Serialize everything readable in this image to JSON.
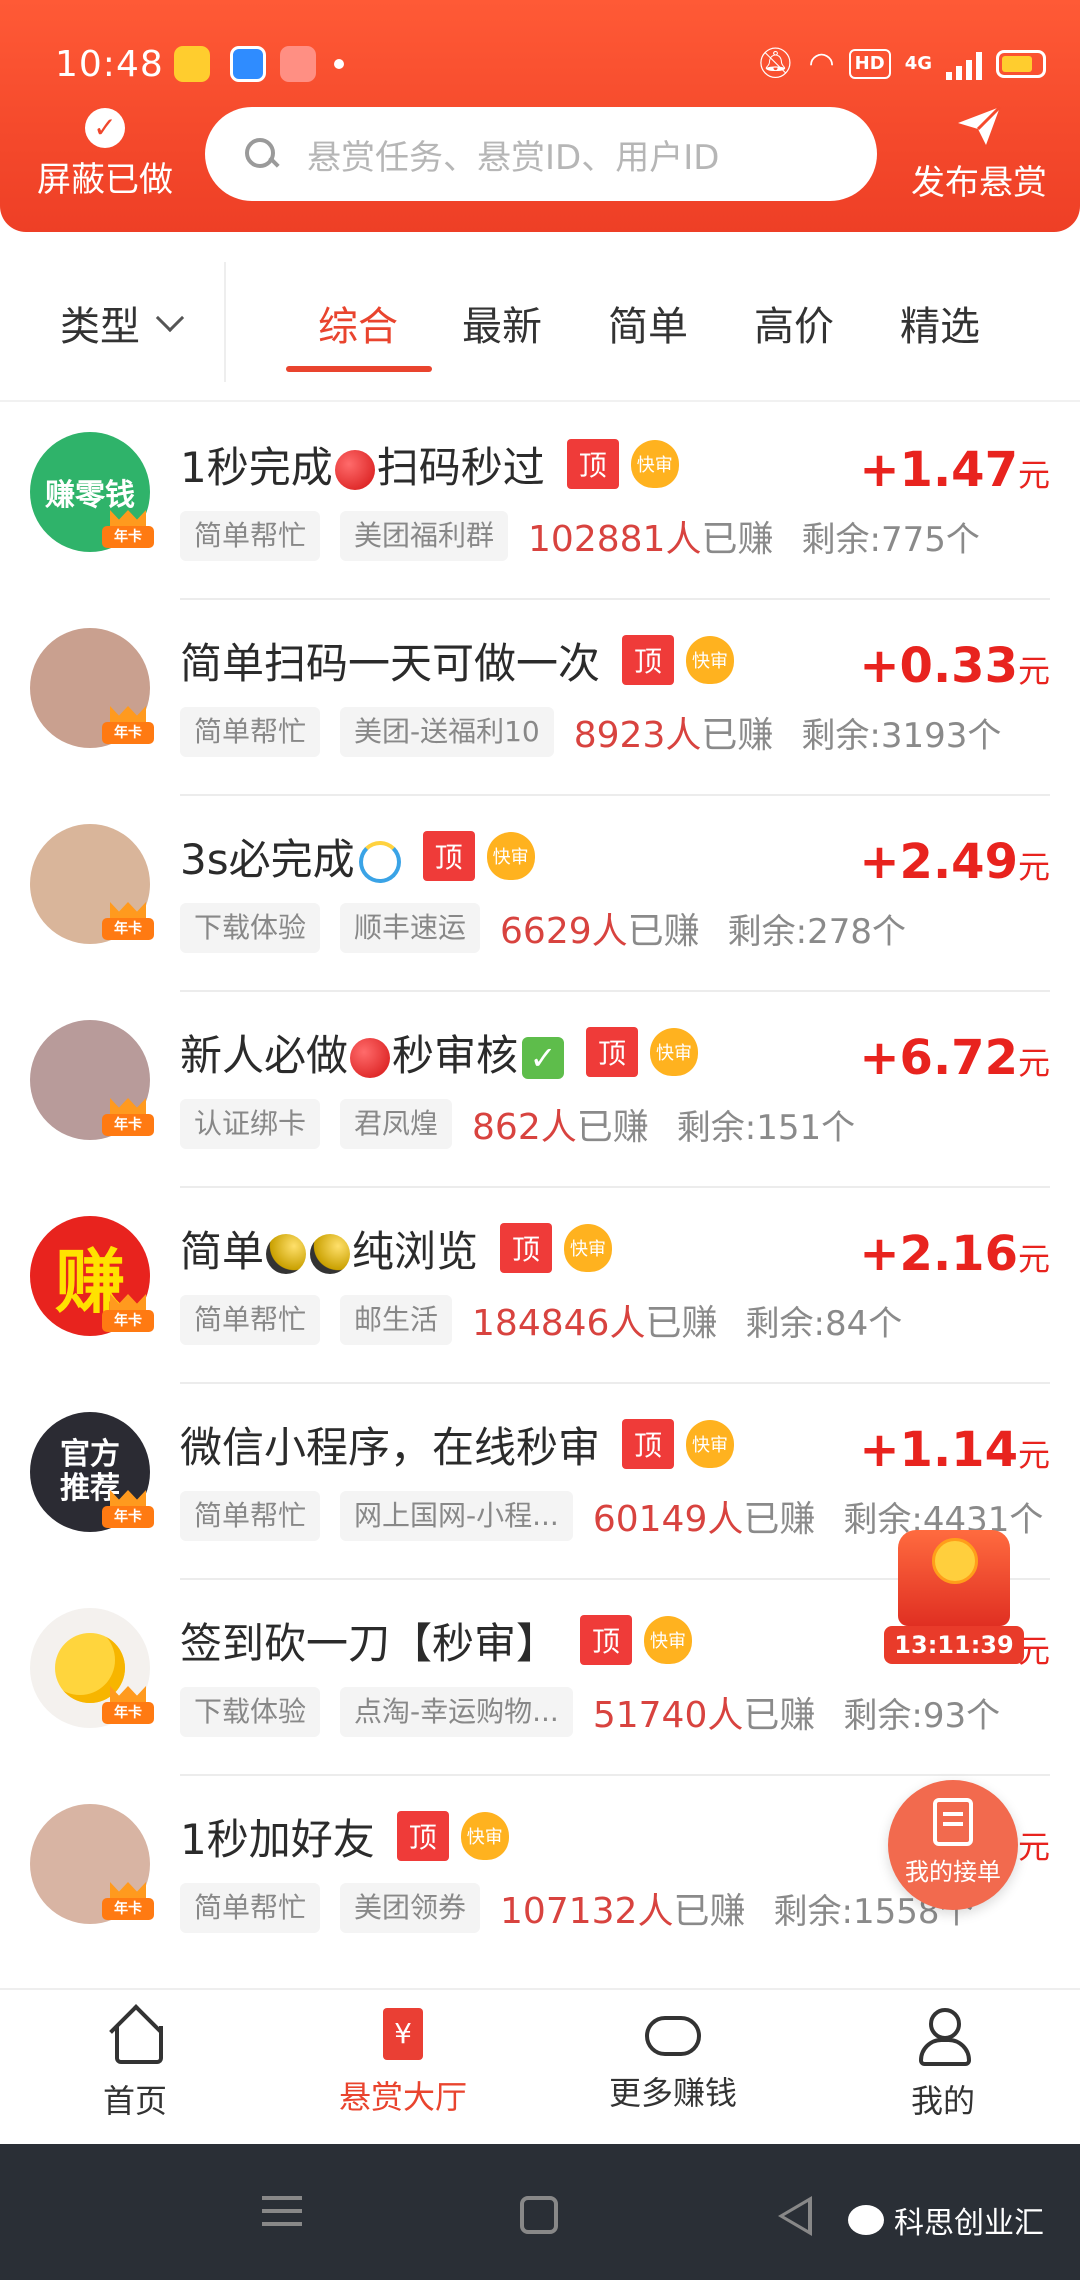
{
  "statusbar": {
    "time": "10:48",
    "network": "4G",
    "hd": "HD"
  },
  "header": {
    "hide_done_label": "屏蔽已做",
    "search_placeholder": "悬赏任务、悬赏ID、用户ID",
    "publish_label": "发布悬赏"
  },
  "filters": {
    "type_label": "类型",
    "tabs": [
      "综合",
      "最新",
      "简单",
      "高价",
      "精选"
    ],
    "active_tab": "综合"
  },
  "badges": {
    "top": "顶",
    "fast": "快审",
    "annual": "年卡"
  },
  "tasks": [
    {
      "title": "1秒完成",
      "title_emoji": "red-circle",
      "title_suffix": "扫码秒过",
      "price": "+1.47",
      "unit": "元",
      "tag1": "简单帮忙",
      "tag2": "美团福利群",
      "earned_count": "102881人",
      "earned_suffix": "已赚",
      "remain": "剩余:775个",
      "avatar_text": "赚零钱",
      "avatar_color": "#2fb36a"
    },
    {
      "title": "简单扫码一天可做一次",
      "title_emoji": "",
      "title_suffix": "",
      "price": "+0.33",
      "unit": "元",
      "tag1": "简单帮忙",
      "tag2": "美团-送福利10",
      "earned_count": "8923人",
      "earned_suffix": "已赚",
      "remain": "剩余:3193个",
      "avatar_text": "",
      "avatar_color": "#c9a08f"
    },
    {
      "title": "3s必完成",
      "title_emoji": "cyclone",
      "title_suffix": "",
      "price": "+2.49",
      "unit": "元",
      "tag1": "下载体验",
      "tag2": "顺丰速运",
      "earned_count": "6629人",
      "earned_suffix": "已赚",
      "remain": "剩余:278个",
      "avatar_text": "",
      "avatar_color": "#d9b59a"
    },
    {
      "title": "新人必做",
      "title_emoji": "red-circle",
      "title_suffix": "秒审核",
      "title_end_emoji": "check",
      "price": "+6.72",
      "unit": "元",
      "tag1": "认证绑卡",
      "tag2": "君凤煌",
      "earned_count": "862人",
      "earned_suffix": "已赚",
      "remain": "剩余:151个",
      "avatar_text": "",
      "avatar_color": "#b89b9a"
    },
    {
      "title": "简单",
      "title_emoji": "moon",
      "title_suffix": "纯浏览",
      "price": "+2.16",
      "unit": "元",
      "tag1": "简单帮忙",
      "tag2": "邮生活",
      "earned_count": "184846人",
      "earned_suffix": "已赚",
      "remain": "剩余:84个",
      "avatar_text": "赚",
      "avatar_color": "#e8231e"
    },
    {
      "title": "微信小程序，在线秒审",
      "title_emoji": "",
      "title_suffix": "",
      "price": "+1.14",
      "unit": "元",
      "tag1": "简单帮忙",
      "tag2": "网上国网-小程...",
      "earned_count": "60149人",
      "earned_suffix": "已赚",
      "remain": "剩余:4431个",
      "avatar_text": "官方推荐",
      "avatar_color": "#2b2b33"
    },
    {
      "title": "签到砍一刀【秒审】",
      "title_emoji": "",
      "title_suffix": "",
      "price": "",
      "unit": "元",
      "tag1": "下载体验",
      "tag2": "点淘-幸运购物...",
      "earned_count": "51740人",
      "earned_suffix": "已赚",
      "remain": "剩余:93个",
      "avatar_text": "",
      "avatar_color": "#f4f1ee"
    },
    {
      "title": "1秒加好友",
      "title_emoji": "",
      "title_suffix": "",
      "price": "",
      "unit": "元",
      "tag1": "简单帮忙",
      "tag2": "美团领券",
      "earned_count": "107132人",
      "earned_suffix": "已赚",
      "remain": "剩余:1558个",
      "avatar_text": "",
      "avatar_color": "#d8b4a3"
    }
  ],
  "floating": {
    "countdown": "13:11:39",
    "my_orders": "我的接单"
  },
  "bottom_nav": {
    "items": [
      "首页",
      "悬赏大厅",
      "更多赚钱",
      "我的"
    ],
    "active": "悬赏大厅",
    "hall_icon_char": "¥"
  },
  "watermark": "科思创业汇",
  "colors": {
    "brand": "#f54a2c",
    "price": "#e8231e",
    "active_tab": "#e9442e"
  }
}
